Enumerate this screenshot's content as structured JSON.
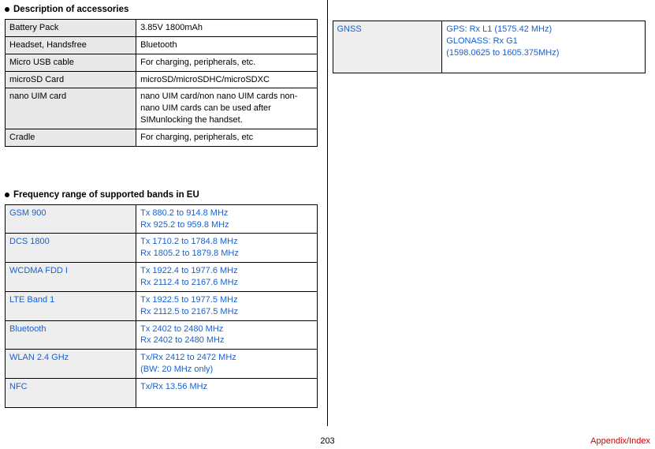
{
  "accessories": {
    "heading": "Description of accessories",
    "rows": [
      {
        "label": "Battery Pack",
        "value": "3.85V 1800mAh"
      },
      {
        "label": "Headset, Handsfree",
        "value": "Bluetooth"
      },
      {
        "label": "Micro USB cable",
        "value": "For charging, peripherals, etc."
      },
      {
        "label": "microSD Card",
        "value": "microSD/microSDHC/microSDXC"
      },
      {
        "label": "nano UIM card",
        "value": "nano UIM card/non nano UIM cards non-nano UIM cards can be used after SIMunlocking the handset."
      },
      {
        "label": "Cradle",
        "value": "For charging, peripherals, etc"
      }
    ]
  },
  "frequency": {
    "heading": "Frequency range of supported bands in EU",
    "rows": [
      {
        "label": "GSM 900",
        "lines": [
          "Tx 880.2 to 914.8 MHz",
          "Rx 925.2 to 959.8 MHz"
        ]
      },
      {
        "label": "DCS 1800",
        "lines": [
          "Tx 1710.2 to 1784.8 MHz",
          "Rx 1805.2 to 1879.8 MHz"
        ]
      },
      {
        "label": "WCDMA FDD I",
        "lines": [
          "Tx 1922.4 to 1977.6 MHz",
          "Rx 2112.4 to 2167.6 MHz"
        ]
      },
      {
        "label": "LTE Band 1",
        "lines": [
          "Tx 1922.5 to 1977.5 MHz",
          "Rx 2112.5 to 2167.5 MHz"
        ]
      },
      {
        "label": "Bluetooth",
        "lines": [
          "Tx 2402 to 2480 MHz",
          "Rx 2402 to 2480 MHz"
        ]
      },
      {
        "label": "WLAN 2.4 GHz",
        "lines": [
          "Tx/Rx 2412 to 2472 MHz",
          "(BW: 20 MHz only)"
        ]
      },
      {
        "label": "NFC",
        "lines": [
          "Tx/Rx 13.56 MHz",
          ""
        ]
      }
    ]
  },
  "gnss": {
    "label": "GNSS",
    "lines": [
      "GPS: Rx L1 (1575.42 MHz)",
      "GLONASS: Rx G1",
      " (1598.0625 to 1605.375MHz)",
      ""
    ]
  },
  "footer": {
    "page": "203",
    "link": "Appendix/Index"
  }
}
